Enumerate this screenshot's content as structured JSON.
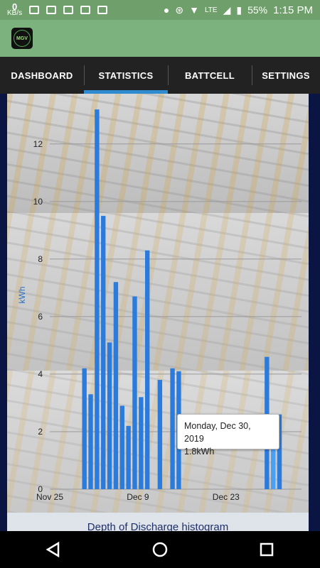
{
  "status_bar": {
    "kbs_value": "0",
    "kbs_unit": "KB/s",
    "network": "LTE",
    "battery": "55%",
    "time": "1:15 PM"
  },
  "app": {
    "logo_text": "MGV"
  },
  "tabs": [
    {
      "label": "DASHBOARD",
      "active": false
    },
    {
      "label": "STATISTICS",
      "active": true
    },
    {
      "label": "BATTCELL",
      "active": false
    },
    {
      "label": "SETTINGS",
      "active": false
    }
  ],
  "chart_data": {
    "type": "bar",
    "ylabel": "kWh",
    "ylim": [
      0,
      13.5
    ],
    "yticks": [
      0,
      2,
      4,
      6,
      8,
      10,
      12
    ],
    "xlim": [
      "2019-11-25",
      "2020-01-04"
    ],
    "xticks": [
      {
        "label": "Nov 25",
        "date": "2019-11-25"
      },
      {
        "label": "Dec 9",
        "date": "2019-12-09"
      },
      {
        "label": "Dec 23",
        "date": "2019-12-23"
      }
    ],
    "grid": true,
    "color": "#2b7bdc",
    "highlight_color": "#49a0f5",
    "points": [
      {
        "date": "2019-11-30",
        "value": 4.2
      },
      {
        "date": "2019-12-01",
        "value": 3.3
      },
      {
        "date": "2019-12-02",
        "value": 13.2
      },
      {
        "date": "2019-12-03",
        "value": 9.5
      },
      {
        "date": "2019-12-04",
        "value": 5.1
      },
      {
        "date": "2019-12-05",
        "value": 7.2
      },
      {
        "date": "2019-12-06",
        "value": 2.9
      },
      {
        "date": "2019-12-07",
        "value": 2.2
      },
      {
        "date": "2019-12-08",
        "value": 6.7
      },
      {
        "date": "2019-12-09",
        "value": 3.2
      },
      {
        "date": "2019-12-10",
        "value": 8.3
      },
      {
        "date": "2019-12-12",
        "value": 3.8
      },
      {
        "date": "2019-12-14",
        "value": 4.2
      },
      {
        "date": "2019-12-15",
        "value": 4.1
      },
      {
        "date": "2019-12-29",
        "value": 4.6
      },
      {
        "date": "2019-12-30",
        "value": 1.7
      },
      {
        "date": "2019-12-31",
        "value": 2.6
      }
    ],
    "tooltip": {
      "date_label": "Monday, Dec 30, 2019",
      "value_label": "1.8kWh"
    }
  },
  "next_section": {
    "title": "Depth of Discharge histogram"
  }
}
